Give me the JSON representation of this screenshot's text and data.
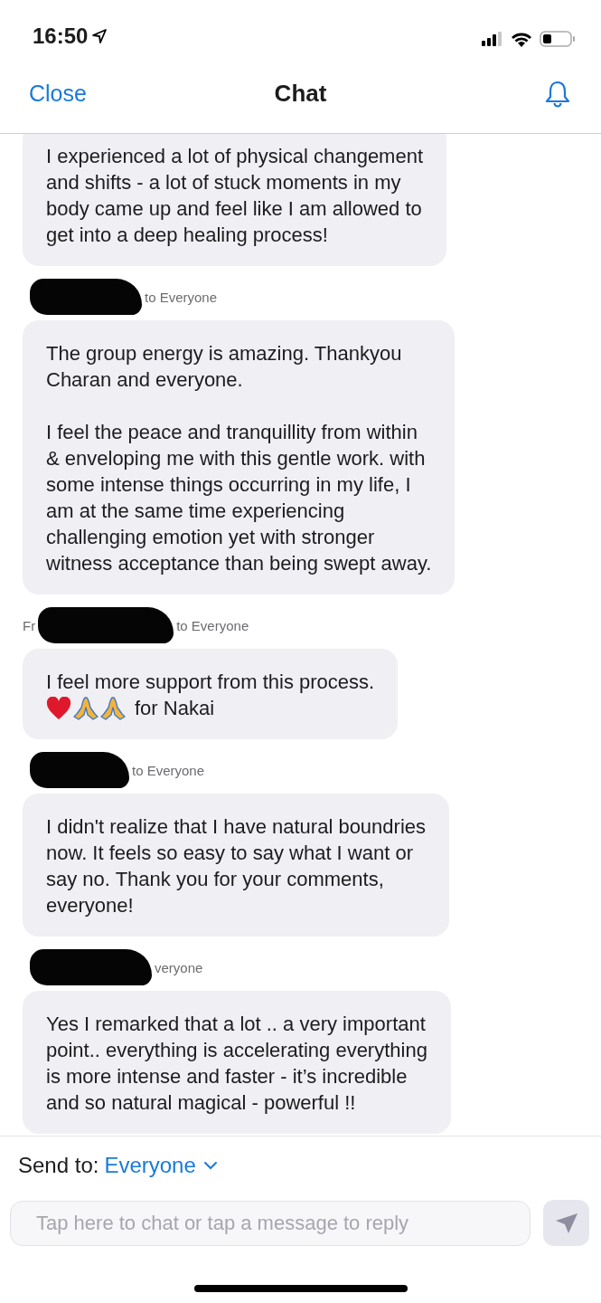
{
  "status_bar": {
    "time": "16:50"
  },
  "nav": {
    "close": "Close",
    "title": "Chat"
  },
  "messages": [
    {
      "kind": "text",
      "paragraphs": [
        [
          "I experienced a lot of physical changement",
          "and shifts - a lot of stuck moments in my",
          "body came up and feel like I am allowed to",
          "get into a deep healing process!"
        ]
      ]
    },
    {
      "kind": "text",
      "sender": {
        "recipient": "to Everyone"
      },
      "paragraphs": [
        [
          "The group energy is amazing. Thankyou",
          "Charan and everyone."
        ],
        [
          "I feel the peace and tranquillity from within",
          "& enveloping me with this gentle work. with",
          "some intense things occurring in my life, I",
          "am at the same time experiencing",
          "challenging emotion yet with stronger",
          "witness acceptance than being swept away."
        ]
      ]
    },
    {
      "kind": "emoji",
      "sender": {
        "lead": "Fr",
        "recipient": "to Everyone"
      },
      "paragraphs": [
        [
          "I feel more support from this process.",
          "for Nakai"
        ]
      ]
    },
    {
      "kind": "text",
      "sender": {
        "recipient": "to Everyone"
      },
      "paragraphs": [
        [
          "I didn't realize that I have natural boundries",
          "now. It feels so easy to say what I want or",
          "say no.  Thank you for your comments,",
          "everyone!"
        ]
      ]
    },
    {
      "kind": "text",
      "sender": {
        "recipient": "veryone"
      },
      "paragraphs": [
        [
          "Yes I remarked that a lot .. a very important",
          "point.. everything is accelerating everything",
          "is more intense and faster - it’s incredible",
          "and so natural magical - powerful !!"
        ]
      ]
    }
  ],
  "composer": {
    "send_to_label": "Send to:",
    "recipient": "Everyone",
    "placeholder": "Tap here to chat or tap a message to reply"
  }
}
